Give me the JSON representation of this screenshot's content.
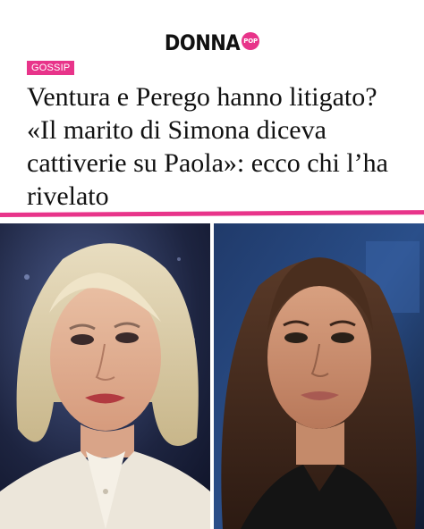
{
  "brand": {
    "logo_text": "DONNA",
    "logo_badge": "POP",
    "accent_color": "#e8348a"
  },
  "article": {
    "category": "GOSSIP",
    "headline": "Ventura e Perego hanno litigato? «Il marito di Simona diceva cattiverie su Paola»: ecco chi l’ha rivelato"
  },
  "images": {
    "left": "photo-of-blonde-woman",
    "right": "photo-of-brunette-woman"
  }
}
